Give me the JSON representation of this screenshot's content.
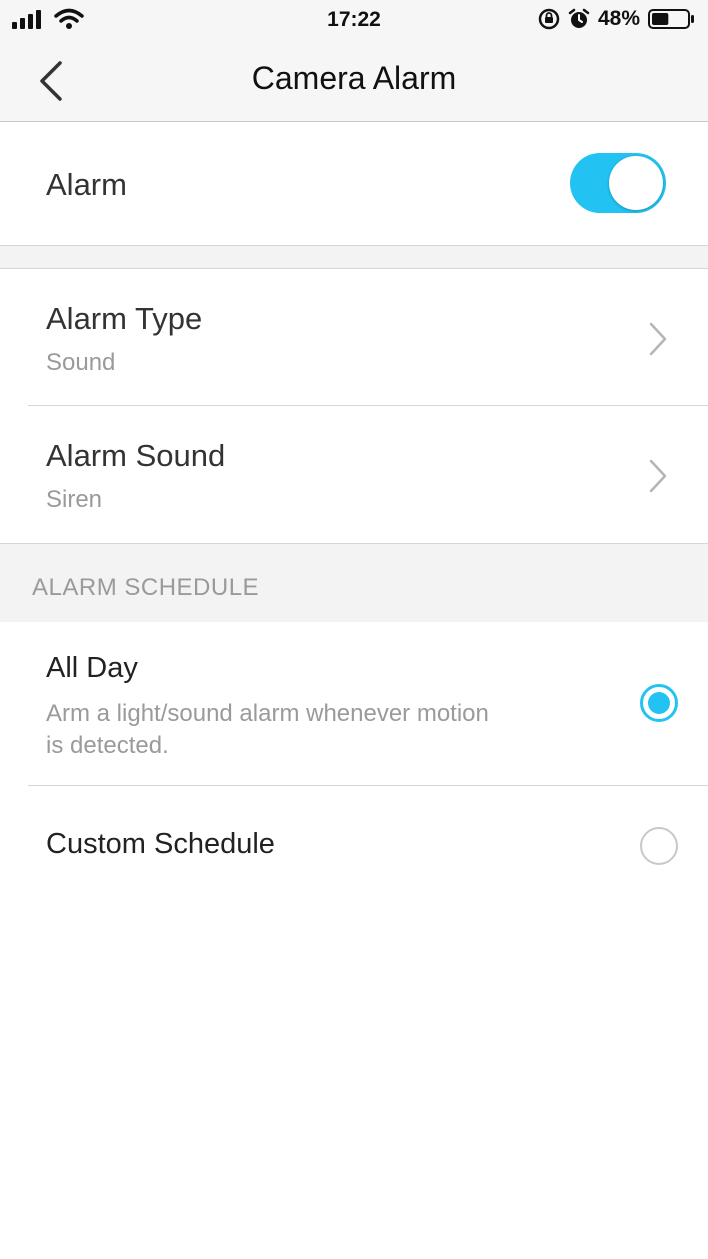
{
  "status_bar": {
    "time": "17:22",
    "battery_percent": "48%",
    "battery_level": 0.48,
    "icons": [
      "signal-icon",
      "wifi-icon",
      "orientation-lock-icon",
      "alarm-clock-icon",
      "battery-icon"
    ]
  },
  "nav": {
    "title": "Camera Alarm"
  },
  "alarm": {
    "label": "Alarm",
    "enabled": true
  },
  "alarm_type": {
    "label": "Alarm Type",
    "value": "Sound"
  },
  "alarm_sound": {
    "label": "Alarm Sound",
    "value": "Siren"
  },
  "schedule": {
    "header": "ALARM SCHEDULE",
    "options": [
      {
        "label": "All Day",
        "description_line1": "Arm a light/sound alarm whenever motion",
        "description_line2": "is detected.",
        "selected": true
      },
      {
        "label": "Custom Schedule",
        "selected": false
      }
    ]
  },
  "colors": {
    "accent": "#22c3f3",
    "background": "#ffffff",
    "group_gap": "#f3f3f3"
  }
}
